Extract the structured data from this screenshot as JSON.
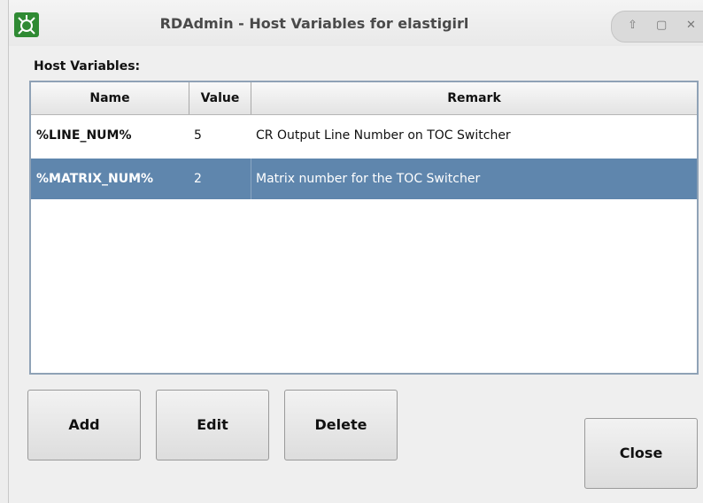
{
  "window": {
    "title": "RDAdmin - Host Variables for elastigirl"
  },
  "section_label": "Host Variables:",
  "table": {
    "columns": [
      "Name",
      "Value",
      "Remark"
    ],
    "rows": [
      {
        "name": "%LINE_NUM%",
        "value": "5",
        "remark": "CR Output Line Number on TOC Switcher",
        "selected": false
      },
      {
        "name": "%MATRIX_NUM%",
        "value": "2",
        "remark": "Matrix number for the TOC Switcher",
        "selected": true
      }
    ]
  },
  "buttons": {
    "add": "Add",
    "edit": "Edit",
    "delete": "Delete",
    "close": "Close"
  },
  "colors": {
    "selection": "#5f86ad",
    "app_icon": "#2f8a33"
  }
}
